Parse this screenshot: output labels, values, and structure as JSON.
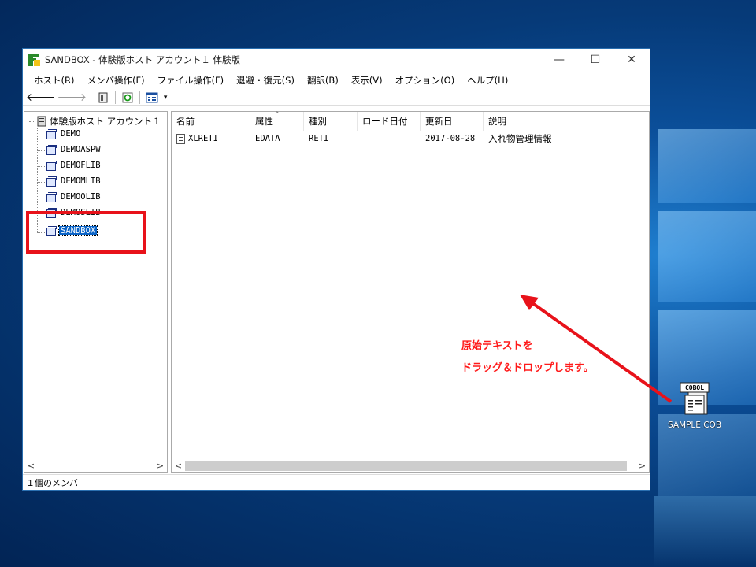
{
  "window": {
    "title": "SANDBOX - 体験版ホスト アカウント１ 体験版",
    "controls": {
      "minimize": "—",
      "maximize": "☐",
      "close": "✕"
    }
  },
  "menu": [
    "ホスト(R)",
    "メンバ操作(F)",
    "ファイル操作(F)",
    "退避・復元(S)",
    "翻訳(B)",
    "表示(V)",
    "オプション(O)",
    "ヘルプ(H)"
  ],
  "toolbar": {
    "back": "🡐",
    "forward": "🡒",
    "view_menu": "▾"
  },
  "tree": {
    "root": "体験版ホスト アカウント１",
    "items": [
      "DEMO",
      "DEMOASPW",
      "DEMOFLIB",
      "DEMOMLIB",
      "DEMOOLIB",
      "DEMOSLIB",
      "SANDBOX"
    ],
    "selected": "SANDBOX"
  },
  "table": {
    "columns": [
      "名前",
      "属性",
      "種別",
      "ロード日付",
      "更新日",
      "説明"
    ],
    "sort_indicator": "^",
    "rows": [
      {
        "name": "XLRETI",
        "attr": "EDATA",
        "type": "RETI",
        "load_date": "",
        "updated": "2017-08-28",
        "desc": "入れ物管理情報"
      }
    ]
  },
  "status": "１個のメンバ",
  "scroll": {
    "left": "<",
    "right": ">"
  },
  "annotation": {
    "line1": "原始テキストを",
    "line2": "ドラッグ＆ドロップします。"
  },
  "desktop_icon": {
    "label": "SAMPLE.COB",
    "badge": "COBOL"
  },
  "colors": {
    "highlight": "#e8121a",
    "selection": "#0a64c8",
    "annotation": "#ff1a1a"
  }
}
